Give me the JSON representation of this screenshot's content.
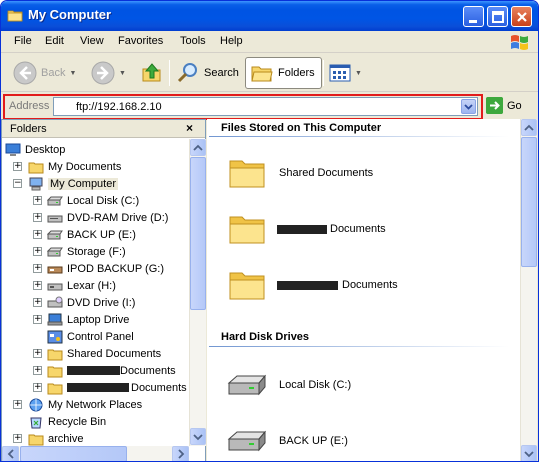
{
  "window": {
    "title": "My Computer"
  },
  "menu": [
    "File",
    "Edit",
    "View",
    "Favorites",
    "Tools",
    "Help"
  ],
  "toolbar": {
    "back": "Back",
    "search": "Search",
    "folders": "Folders"
  },
  "address": {
    "label": "Address",
    "value": "ftp://192.168.2.10",
    "go": "Go"
  },
  "folders_pane": {
    "title": "Folders",
    "close": "×",
    "items": [
      {
        "label": "Desktop"
      },
      {
        "label": "My Documents"
      },
      {
        "label": "My Computer"
      },
      {
        "label": "Local Disk (C:)"
      },
      {
        "label": "DVD-RAM Drive (D:)"
      },
      {
        "label": "BACK UP (E:)"
      },
      {
        "label": "Storage (F:)"
      },
      {
        "label": "IPOD BACKUP (G:)"
      },
      {
        "label": "Lexar (H:)"
      },
      {
        "label": "DVD Drive (I:)"
      },
      {
        "label": "Laptop Drive"
      },
      {
        "label": "Control Panel"
      },
      {
        "label": "Shared Documents"
      },
      {
        "label": "Documents"
      },
      {
        "label": "Documents"
      },
      {
        "label": "My Network Places"
      },
      {
        "label": "Recycle Bin"
      },
      {
        "label": "archive"
      }
    ]
  },
  "content": {
    "group1": "Files Stored on This Computer",
    "files": [
      {
        "label": "Shared Documents"
      },
      {
        "label": "Documents"
      },
      {
        "label": "Documents"
      }
    ],
    "group2": "Hard Disk Drives",
    "drives": [
      {
        "label": "Local Disk (C:)"
      },
      {
        "label": "BACK UP (E:)"
      }
    ]
  }
}
